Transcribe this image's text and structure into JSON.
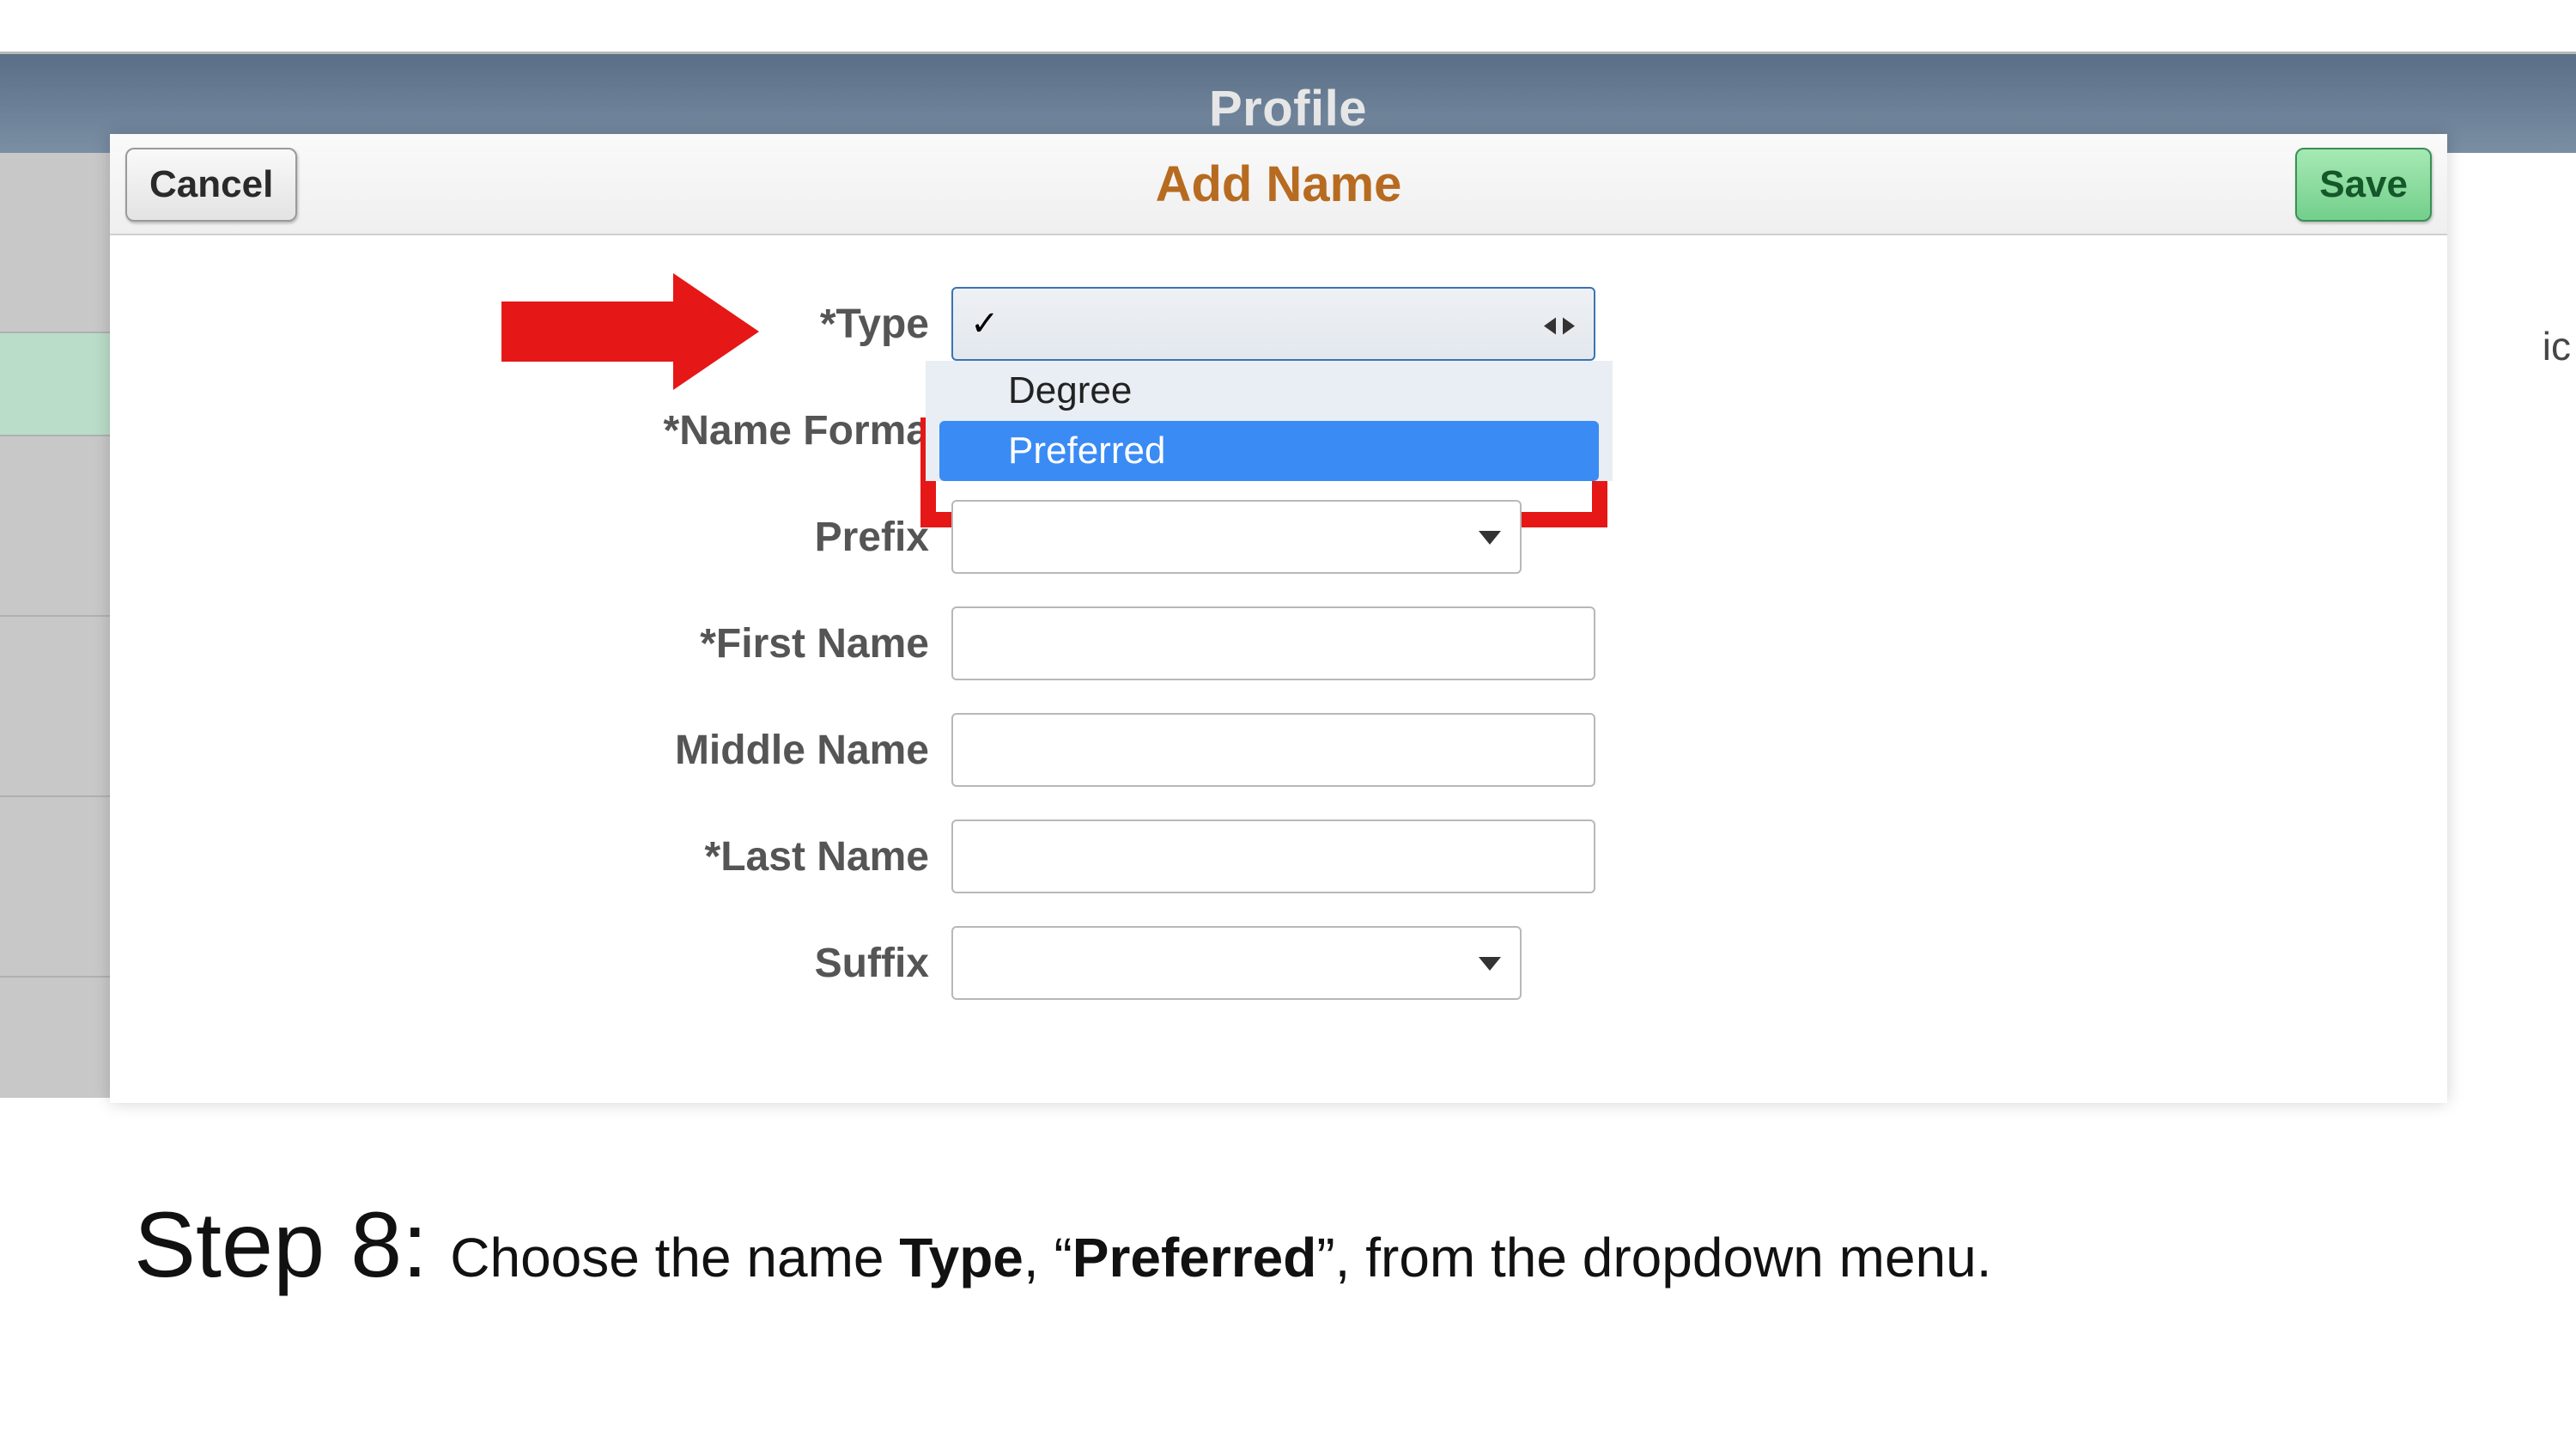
{
  "background": {
    "topbar_title": "Profile",
    "right_truncated_text": "ic"
  },
  "modal": {
    "title": "Add Name",
    "cancel_label": "Cancel",
    "save_label": "Save"
  },
  "form": {
    "type_label": "*Type",
    "type_options": {
      "checkmark": "✓",
      "opt1": "Degree",
      "opt2": "Preferred"
    },
    "name_format_label": "*Name Forma",
    "prefix_label": "Prefix",
    "first_name_label": "*First Name",
    "middle_name_label": "Middle Name",
    "last_name_label": "*Last Name",
    "suffix_label": "Suffix"
  },
  "instructions": {
    "step_label": "Step 8:",
    "text_pre": "Choose the name ",
    "text_bold1": "Type",
    "text_mid": ", “",
    "text_bold2": "Preferred",
    "text_post": "”, from the dropdown menu."
  }
}
